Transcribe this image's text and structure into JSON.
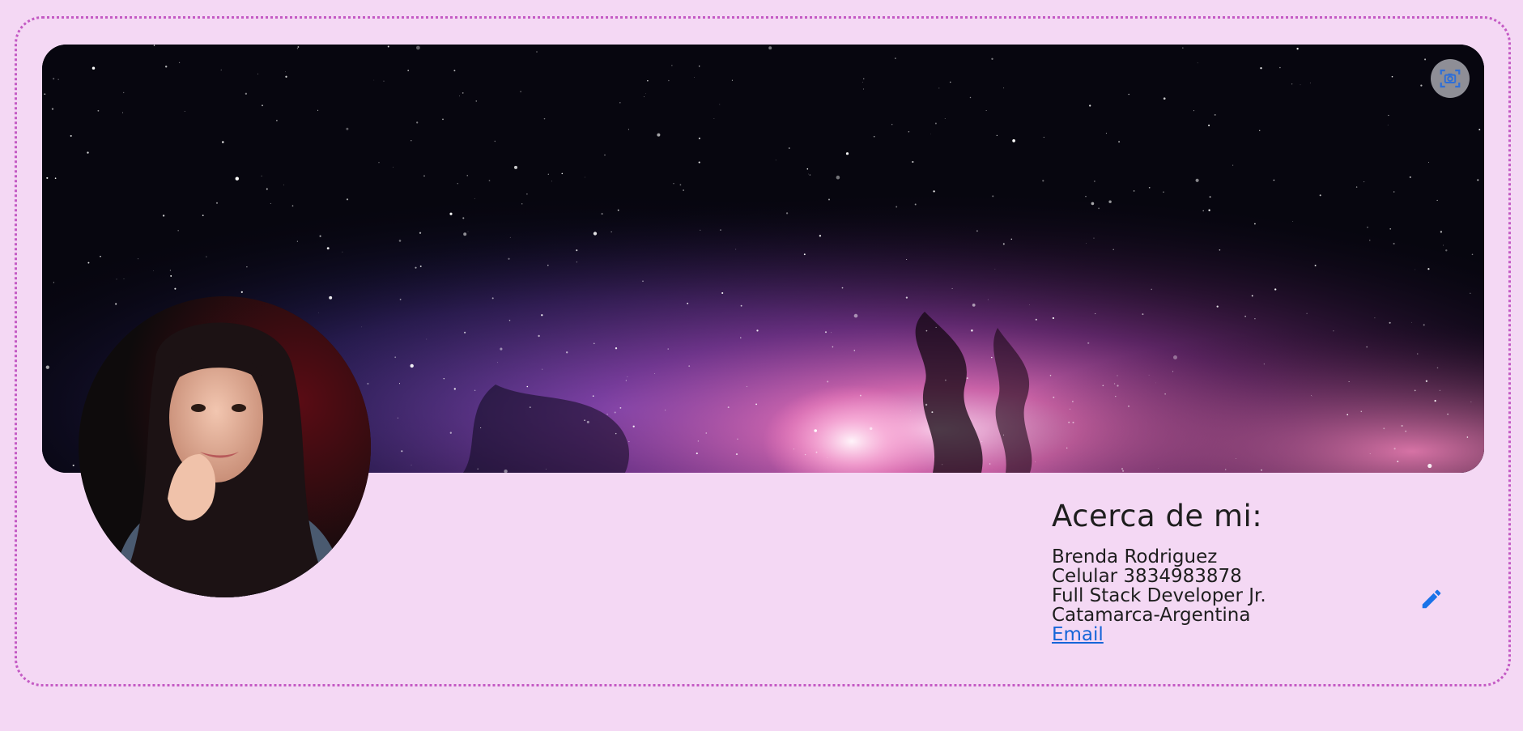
{
  "profile": {
    "about_title": "Acerca de mi:",
    "name": "Brenda Rodriguez",
    "phone": "Celular 3834983878",
    "role": "Full Stack Developer Jr.",
    "location": "Catamarca-Argentina",
    "email_link": "Email"
  },
  "icons": {
    "banner_action": "camera-focus-icon",
    "edit": "pencil-icon"
  },
  "colors": {
    "background": "#f4d8f4",
    "card_border": "#c45ac4",
    "link": "#1565d8",
    "edit_icon": "#1a73e8"
  }
}
